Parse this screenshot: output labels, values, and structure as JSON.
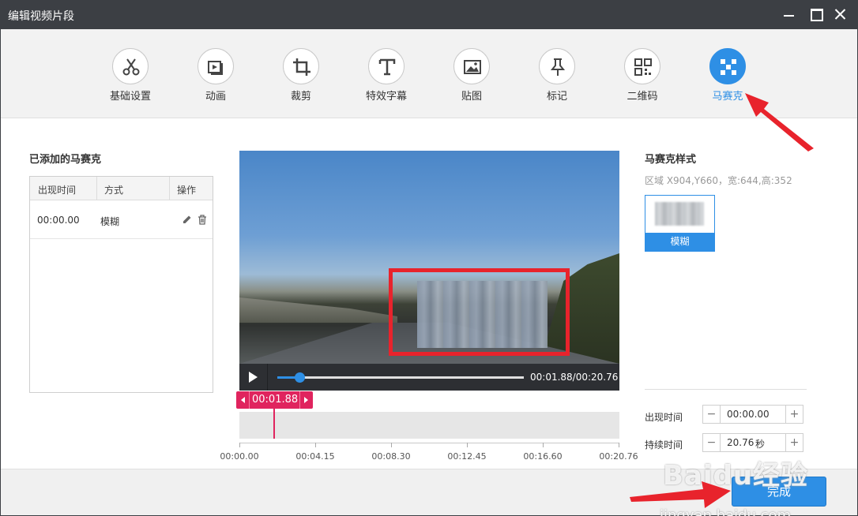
{
  "window": {
    "title": "编辑视频片段"
  },
  "toolbar": {
    "tools": [
      {
        "label": "基础设置",
        "icon": "scissors-icon"
      },
      {
        "label": "动画",
        "icon": "animation-icon"
      },
      {
        "label": "裁剪",
        "icon": "crop-icon"
      },
      {
        "label": "特效字幕",
        "icon": "text-icon"
      },
      {
        "label": "贴图",
        "icon": "image-icon"
      },
      {
        "label": "标记",
        "icon": "pin-icon"
      },
      {
        "label": "二维码",
        "icon": "qrcode-icon"
      },
      {
        "label": "马赛克",
        "icon": "mosaic-icon",
        "active": true
      }
    ]
  },
  "mosaic_list": {
    "title": "已添加的马赛克",
    "columns": [
      "出现时间",
      "方式",
      "操作"
    ],
    "rows": [
      {
        "time": "00:00.00",
        "mode": "模糊"
      }
    ]
  },
  "player": {
    "time_display": "00:01.88/00:20.76",
    "progress": 0.09
  },
  "timeline": {
    "current": "00:01.88",
    "ticks": [
      "00:00.00",
      "00:04.15",
      "00:08.30",
      "00:12.45",
      "00:16.60",
      "00:20.76"
    ]
  },
  "mosaic_style": {
    "title": "马赛克样式",
    "region": "区域 X904,Y660，宽:644,高:352",
    "option_label": "模糊"
  },
  "timing": {
    "appear_label": "出现时间",
    "appear_value": "00:00.00",
    "duration_label": "持续时间",
    "duration_value": "20.76",
    "duration_unit": "秒"
  },
  "footer": {
    "done_label": "完成"
  },
  "watermark": {
    "logo": "Baidu经验",
    "url": "jingyan.baidu.com"
  },
  "colors": {
    "accent": "#2e8fe5",
    "marker": "#e0245e",
    "mosaic_frame": "#e8232c",
    "titlebar": "#3c3f44"
  }
}
